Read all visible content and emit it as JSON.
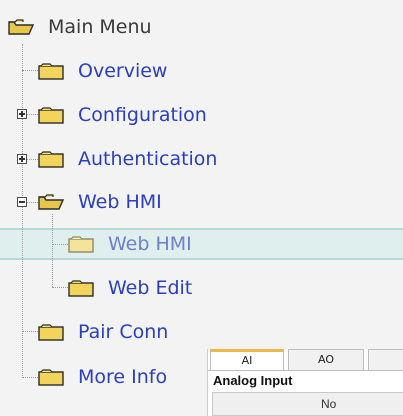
{
  "tree": {
    "root": "Main Menu",
    "items": [
      {
        "label": "Overview"
      },
      {
        "label": "Configuration"
      },
      {
        "label": "Authentication"
      },
      {
        "label": "Web HMI"
      },
      {
        "label": "Web HMI"
      },
      {
        "label": "Web Edit"
      },
      {
        "label": "Pair Conn"
      },
      {
        "label": "More Info"
      }
    ]
  },
  "panel": {
    "tabs": [
      "AI",
      "AO",
      ""
    ],
    "title": "Analog Input",
    "table_header": "No"
  },
  "colors": {
    "link": "#2a3fbf",
    "selected_link": "#6f7fd0",
    "selection_band": "#dfefee",
    "folder": "#f2d45a"
  },
  "icons": {
    "folder_open": "folder-open-icon",
    "folder_closed": "folder-icon",
    "expand": "expand-plus-icon",
    "collapse": "collapse-minus-icon"
  }
}
